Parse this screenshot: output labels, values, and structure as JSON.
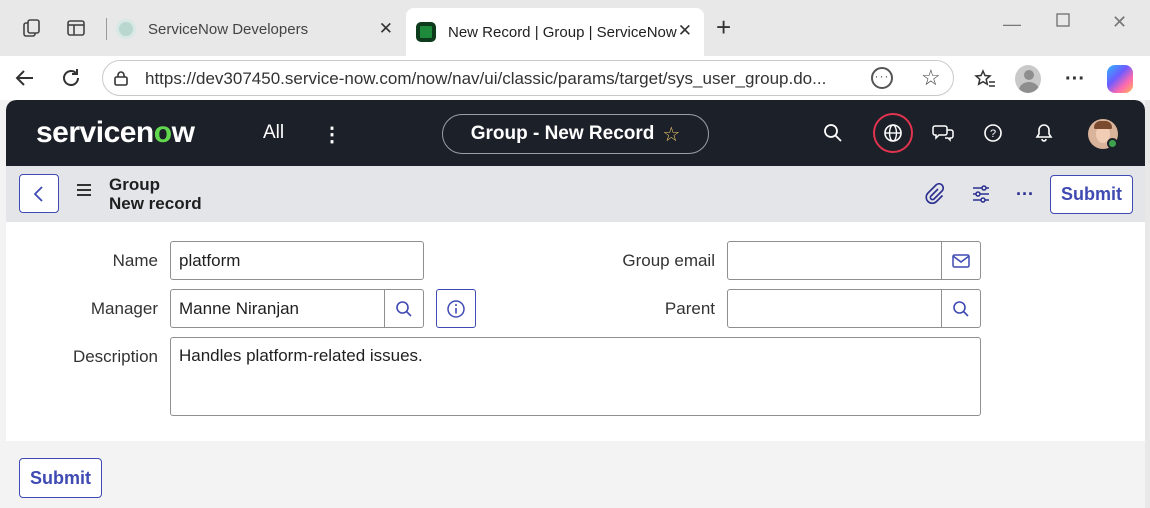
{
  "browser": {
    "tabs": [
      {
        "label": "ServiceNow Developers",
        "active": false
      },
      {
        "label": "New Record | Group | ServiceNow",
        "active": true
      }
    ],
    "url": "https://dev307450.service-now.com/now/nav/ui/classic/params/target/sys_user_group.do..."
  },
  "header": {
    "logo_text_before": "servicen",
    "logo_text_o": "o",
    "logo_text_after": "w",
    "all_label": "All",
    "context_title": "Group - New Record"
  },
  "formbar": {
    "title_line1": "Group",
    "title_line2": "New record",
    "submit_label": "Submit"
  },
  "form": {
    "name_label": "Name",
    "name_value": "platform",
    "manager_label": "Manager",
    "manager_value": "Manne Niranjan",
    "description_label": "Description",
    "description_value": "Handles platform-related issues.",
    "group_email_label": "Group email",
    "group_email_value": "",
    "parent_label": "Parent",
    "parent_value": ""
  },
  "footer": {
    "submit_label": "Submit"
  },
  "colors": {
    "header_bg": "#1c2029",
    "accent": "#3f4ab3",
    "logo_green": "#62d84e",
    "focus_ring": "#e0334d"
  }
}
